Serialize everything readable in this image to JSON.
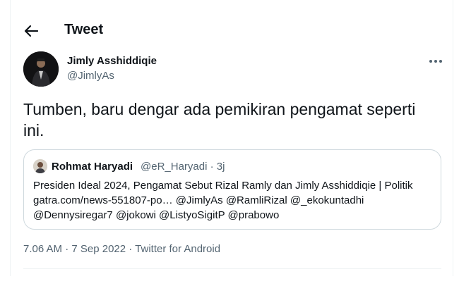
{
  "header": {
    "title": "Tweet",
    "back_icon": "arrow-left-icon"
  },
  "tweet": {
    "author_name": "Jimly Asshiddiqie",
    "author_handle": "@JimlyAs",
    "text": "Tumben, baru dengar ada pemikiran pengamat seperti ini.",
    "more_icon": "more-horizontal-icon",
    "timestamp": "7.06 AM · 7 Sep 2022 · Twitter for Android"
  },
  "quote": {
    "author_name": "Rohmat Haryadi",
    "meta": "@eR_Haryadi · 3j",
    "lines": [
      "Presiden Ideal 2024, Pengamat Sebut Rizal Ramly dan Jimly Asshiddiqie | Politik",
      "gatra.com/news-551807-po… @JimlyAs @RamliRizal @_ekokuntadhi",
      "@Dennysiregar7 @jokowi @ListyoSigitP @prabowo"
    ]
  },
  "colors": {
    "text_primary": "#0f1419",
    "text_secondary": "#536471",
    "border": "#cfd9de",
    "divider": "#eff3f4"
  }
}
